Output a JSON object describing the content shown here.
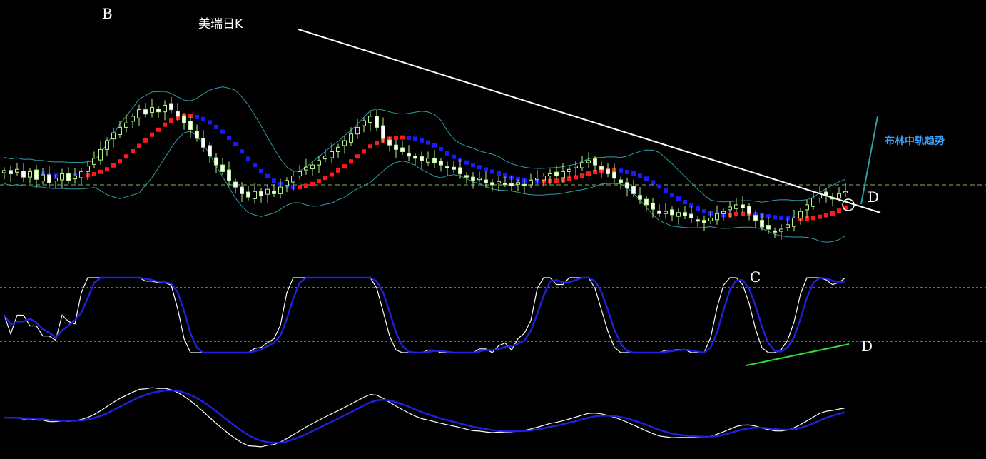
{
  "chart_data": {
    "type": "candlestick",
    "title": "美瑞日K",
    "annotations": {
      "trend_note": "布林中轨趋势",
      "point_b": "B",
      "point_c": "C",
      "point_d_price": "D",
      "point_d_osc": "D"
    },
    "colors": {
      "background": "#000000",
      "candle_up": "#b4f08c",
      "candle_down": "#ffffff",
      "bollinger": "#2f9aa6",
      "mid_up": "#ff1a1a",
      "mid_down": "#1a1aff",
      "trendline": "#ffffff",
      "reference_line": "#7fb86a",
      "osc_fast": "#ffffff",
      "osc_slow": "#2020e0",
      "divergence_line": "#33dd33",
      "trend_note": "#3aa0ff",
      "trend_arrow": "#2aa0a8"
    },
    "close_series": [
      171,
      168,
      172,
      165,
      170,
      163,
      167,
      160,
      164,
      168,
      162,
      166,
      170,
      175,
      182,
      190,
      198,
      205,
      210,
      214,
      220,
      226,
      222,
      228,
      224,
      230,
      226,
      220,
      214,
      208,
      200,
      192,
      184,
      176,
      170,
      162,
      156,
      150,
      147,
      152,
      148,
      154,
      150,
      156,
      162,
      166,
      170,
      174,
      176,
      180,
      184,
      188,
      192,
      198,
      204,
      210,
      216,
      220,
      210,
      200,
      194,
      190,
      188,
      184,
      182,
      180,
      182,
      178,
      176,
      174,
      172,
      168,
      165,
      162,
      164,
      160,
      158,
      161,
      159,
      157,
      160,
      158,
      162,
      164,
      166,
      168,
      166,
      170,
      172,
      175,
      178,
      180,
      176,
      172,
      168,
      164,
      160,
      155,
      150,
      145,
      140,
      136,
      132,
      134,
      131,
      133,
      130,
      128,
      126,
      124,
      128,
      132,
      134,
      138,
      140,
      137,
      132,
      126,
      120,
      118,
      116,
      118,
      122,
      128,
      134,
      140,
      146,
      150,
      148,
      146,
      150,
      152
    ]
  }
}
